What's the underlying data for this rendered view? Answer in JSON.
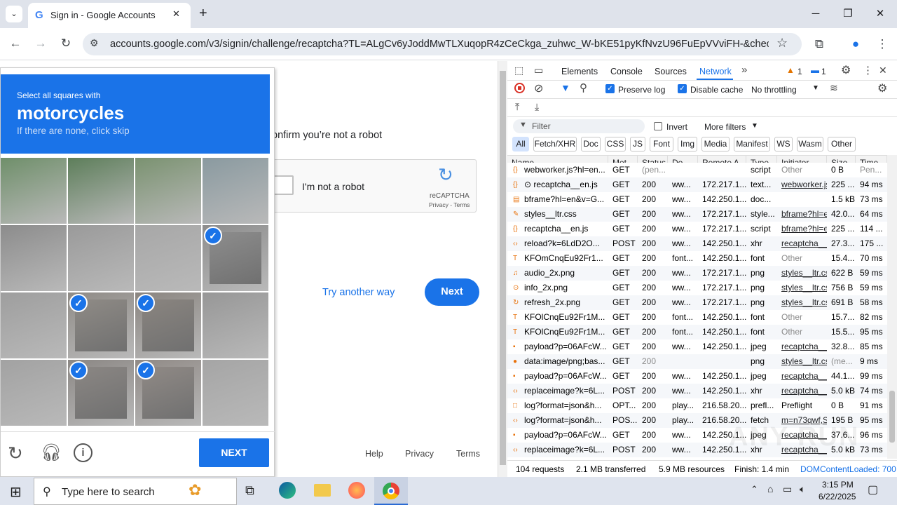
{
  "browser": {
    "tab_title": "Sign in - Google Accounts",
    "new_tab": "+",
    "url": "accounts.google.com/v3/signin/challenge/recaptcha?TL=ALgCv6yJoddMwTLXuqopR4zCeCkga_zuhwc_W-bKE51pyKfNvzU96FuEpVVviFH-&checkConn...",
    "minimize": "─",
    "maximize": "❐",
    "close": "✕"
  },
  "page": {
    "confirm_text": "onfirm you’re not a robot",
    "checkbox_label": "I'm not a robot",
    "recaptcha_brand": "reCAPTCHA",
    "recaptcha_links": "Privacy - Terms",
    "try_another": "Try another way",
    "next": "Next",
    "footer": [
      "Help",
      "Privacy",
      "Terms"
    ]
  },
  "captcha": {
    "instruction": "Select all squares with",
    "object": "motorcycles",
    "hint": "If there are none, click skip",
    "next_button": "NEXT",
    "tiles_selected": [
      false,
      false,
      false,
      false,
      false,
      false,
      false,
      true,
      false,
      true,
      true,
      false,
      false,
      true,
      true,
      false
    ]
  },
  "devtools": {
    "tabs": [
      "Elements",
      "Console",
      "Sources",
      "Network"
    ],
    "active_tab": "Network",
    "warnings": "1",
    "messages": "1",
    "preserve_log": "Preserve log",
    "disable_cache": "Disable cache",
    "throttling": "No throttling",
    "filter_placeholder": "Filter",
    "invert": "Invert",
    "more_filters": "More filters",
    "type_filters": [
      "All",
      "Fetch/XHR",
      "Doc",
      "CSS",
      "JS",
      "Font",
      "Img",
      "Media",
      "Manifest",
      "WS",
      "Wasm",
      "Other"
    ],
    "columns": [
      "Name",
      "Met...",
      "Status",
      "Do...",
      "Remote A...",
      "Type",
      "Initiator",
      "Size",
      "Time"
    ],
    "rows": [
      {
        "name": "webworker.js?hl=en...",
        "method": "GET",
        "status": "(pen...",
        "domain": "",
        "remote": "",
        "type": "script",
        "initiator": "Other",
        "size": "0 B",
        "time": "Pen...",
        "icon": "{}"
      },
      {
        "name": "⊙ recaptcha__en.js",
        "method": "GET",
        "status": "200",
        "domain": "ww...",
        "remote": "172.217.1...",
        "type": "text...",
        "initiator": "webworker.js",
        "size": "225 ...",
        "time": "94 ms",
        "icon": "{}"
      },
      {
        "name": "bframe?hl=en&v=G...",
        "method": "GET",
        "status": "200",
        "domain": "ww...",
        "remote": "142.250.1...",
        "type": "doc...",
        "initiator": "",
        "size": "1.5 kB",
        "time": "73 ms",
        "icon": "▤"
      },
      {
        "name": "styles__ltr.css",
        "method": "GET",
        "status": "200",
        "domain": "ww...",
        "remote": "172.217.1...",
        "type": "style...",
        "initiator": "bframe?hl=e",
        "size": "42.0...",
        "time": "64 ms",
        "icon": "✎"
      },
      {
        "name": "recaptcha__en.js",
        "method": "GET",
        "status": "200",
        "domain": "ww...",
        "remote": "172.217.1...",
        "type": "script",
        "initiator": "bframe?hl=e",
        "size": "225 ...",
        "time": "114 ...",
        "icon": "{}"
      },
      {
        "name": "reload?k=6LdD2O...",
        "method": "POST",
        "status": "200",
        "domain": "ww...",
        "remote": "142.250.1...",
        "type": "xhr",
        "initiator": "recaptcha__e",
        "size": "27.3...",
        "time": "175 ...",
        "icon": "‹›"
      },
      {
        "name": "KFOmCnqEu92Fr1...",
        "method": "GET",
        "status": "200",
        "domain": "font...",
        "remote": "142.250.1...",
        "type": "font",
        "initiator": "Other",
        "size": "15.4...",
        "time": "70 ms",
        "icon": "T"
      },
      {
        "name": "audio_2x.png",
        "method": "GET",
        "status": "200",
        "domain": "ww...",
        "remote": "172.217.1...",
        "type": "png",
        "initiator": "styles__ltr.css",
        "size": "622 B",
        "time": "59 ms",
        "icon": "♫"
      },
      {
        "name": "info_2x.png",
        "method": "GET",
        "status": "200",
        "domain": "ww...",
        "remote": "172.217.1...",
        "type": "png",
        "initiator": "styles__ltr.css",
        "size": "756 B",
        "time": "59 ms",
        "icon": "⊙"
      },
      {
        "name": "refresh_2x.png",
        "method": "GET",
        "status": "200",
        "domain": "ww...",
        "remote": "172.217.1...",
        "type": "png",
        "initiator": "styles__ltr.css",
        "size": "691 B",
        "time": "58 ms",
        "icon": "↻"
      },
      {
        "name": "KFOlCnqEu92Fr1M...",
        "method": "GET",
        "status": "200",
        "domain": "font...",
        "remote": "142.250.1...",
        "type": "font",
        "initiator": "Other",
        "size": "15.7...",
        "time": "82 ms",
        "icon": "T"
      },
      {
        "name": "KFOlCnqEu92Fr1M...",
        "method": "GET",
        "status": "200",
        "domain": "font...",
        "remote": "142.250.1...",
        "type": "font",
        "initiator": "Other",
        "size": "15.5...",
        "time": "95 ms",
        "icon": "T"
      },
      {
        "name": "payload?p=06AFcW...",
        "method": "GET",
        "status": "200",
        "domain": "ww...",
        "remote": "142.250.1...",
        "type": "jpeg",
        "initiator": "recaptcha__e",
        "size": "32.8...",
        "time": "85 ms",
        "icon": "▪"
      },
      {
        "name": "data:image/png;bas...",
        "method": "GET",
        "status": "200",
        "domain": "",
        "remote": "",
        "type": "png",
        "initiator": "styles__ltr.css",
        "size": "(me...",
        "time": "9 ms",
        "icon": "●"
      },
      {
        "name": "payload?p=06AFcW...",
        "method": "GET",
        "status": "200",
        "domain": "ww...",
        "remote": "142.250.1...",
        "type": "jpeg",
        "initiator": "recaptcha__e",
        "size": "44.1...",
        "time": "99 ms",
        "icon": "▪"
      },
      {
        "name": "replaceimage?k=6L...",
        "method": "POST",
        "status": "200",
        "domain": "ww...",
        "remote": "142.250.1...",
        "type": "xhr",
        "initiator": "recaptcha__e",
        "size": "5.0 kB",
        "time": "74 ms",
        "icon": "‹›"
      },
      {
        "name": "log?format=json&h...",
        "method": "OPT...",
        "status": "200",
        "domain": "play...",
        "remote": "216.58.20...",
        "type": "prefl...",
        "initiator": "Preflight",
        "size": "0 B",
        "time": "91 ms",
        "icon": "□"
      },
      {
        "name": "log?format=json&h...",
        "method": "POS...",
        "status": "200",
        "domain": "play...",
        "remote": "216.58.20...",
        "type": "fetch",
        "initiator": "m=n73qwf,S",
        "size": "195 B",
        "time": "95 ms",
        "icon": "‹›"
      },
      {
        "name": "payload?p=06AFcW...",
        "method": "GET",
        "status": "200",
        "domain": "ww...",
        "remote": "142.250.1...",
        "type": "jpeg",
        "initiator": "recaptcha__e",
        "size": "37.6...",
        "time": "96 ms",
        "icon": "▪"
      },
      {
        "name": "replaceimage?k=6L...",
        "method": "POST",
        "status": "200",
        "domain": "ww...",
        "remote": "142.250.1...",
        "type": "xhr",
        "initiator": "recaptcha__e",
        "size": "5.0 kB",
        "time": "73 ms",
        "icon": "‹›"
      }
    ],
    "status_requests": "104 requests",
    "status_transferred": "2.1 MB transferred",
    "status_resources": "5.9 MB resources",
    "status_finish": "Finish: 1.4 min",
    "status_dcl": "DOMContentLoaded: 700"
  },
  "taskbar": {
    "search_placeholder": "Type here to search",
    "time": "3:15 PM",
    "date": "6/22/2025"
  },
  "watermark": "ANY RUN"
}
